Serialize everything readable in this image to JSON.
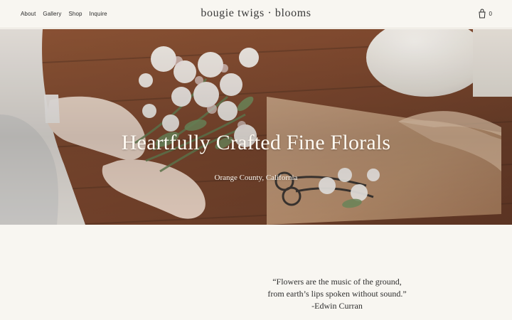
{
  "header": {
    "brand": "bougie twigs · blooms",
    "nav": [
      "About",
      "Gallery",
      "Shop",
      "Inquire"
    ],
    "cart_count": "0"
  },
  "hero": {
    "title": "Heartfully Crafted Fine Florals",
    "subtitle": "Orange County, California"
  },
  "quote": {
    "line1": "“Flowers are the music of the ground,",
    "line2": "from earth’s lips spoken without sound.”",
    "author": "-Edwin Curran"
  },
  "colors": {
    "background": "#f8f6f1",
    "hero_text": "#fffaf2",
    "text": "#2b2b2b"
  },
  "icons": {
    "cart": "shopping-bag-icon"
  }
}
